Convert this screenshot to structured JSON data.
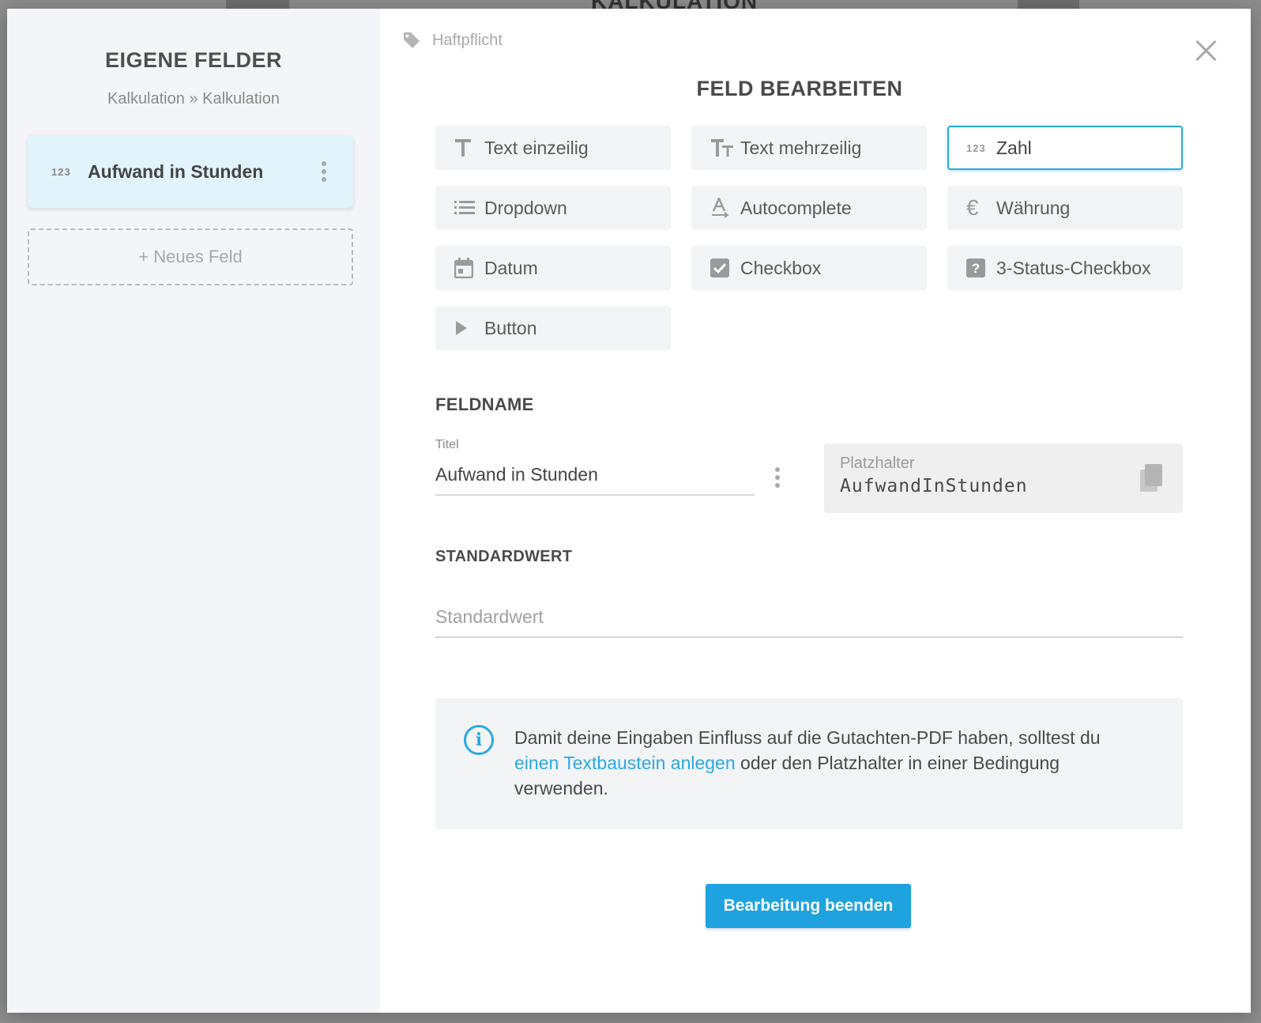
{
  "background": {
    "page_title": "KALKULATION"
  },
  "sidebar": {
    "title": "EIGENE FELDER",
    "breadcrumb": "Kalkulation » Kalkulation",
    "field": {
      "icon": "123",
      "label": "Aufwand in Stunden"
    },
    "new_field_label": "+ Neues Feld"
  },
  "main": {
    "tag_label": "Haftpflicht",
    "title": "FELD BEARBEITEN",
    "types": [
      {
        "label": "Text einzeilig",
        "icon": "text-single-icon",
        "active": false
      },
      {
        "label": "Text mehrzeilig",
        "icon": "text-multi-icon",
        "active": false
      },
      {
        "label": "Zahl",
        "icon": "number-icon",
        "active": true
      },
      {
        "label": "Dropdown",
        "icon": "list-icon",
        "active": false
      },
      {
        "label": "Autocomplete",
        "icon": "autocomplete-icon",
        "active": false
      },
      {
        "label": "Währung",
        "icon": "euro-icon",
        "active": false
      },
      {
        "label": "Datum",
        "icon": "calendar-icon",
        "active": false
      },
      {
        "label": "Checkbox",
        "icon": "checkbox-icon",
        "active": false
      },
      {
        "label": "3-Status-Checkbox",
        "icon": "tristate-checkbox-icon",
        "active": false
      },
      {
        "label": "Button",
        "icon": "play-icon",
        "active": false
      }
    ],
    "fieldname": {
      "heading": "FELDNAME",
      "title_label": "Titel",
      "title_value": "Aufwand in Stunden",
      "placeholder_label": "Platzhalter",
      "placeholder_value": "AufwandInStunden"
    },
    "default": {
      "heading": "STANDARDWERT",
      "placeholder": "Standardwert"
    },
    "info": {
      "text_before": "Damit deine Eingaben Einfluss auf die Gutachten-PDF haben, solltest du",
      "link": "einen Textbaustein anlegen",
      "text_after": "oder den Platzhalter in einer Bedingung verwenden."
    },
    "finish_button": "Bearbeitung beenden"
  },
  "colors": {
    "accent": "#29a9e1",
    "button": "#1fa3e0",
    "sidebar_bg": "#f3f5f8",
    "selected_card": "#e1f3fb"
  }
}
